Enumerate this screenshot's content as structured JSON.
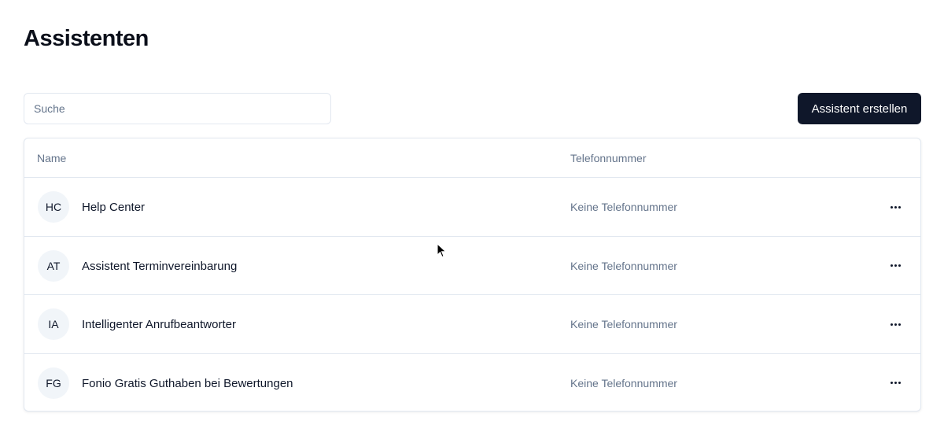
{
  "page": {
    "title": "Assistenten"
  },
  "search": {
    "placeholder": "Suche",
    "value": ""
  },
  "toolbar": {
    "create_label": "Assistent erstellen"
  },
  "table": {
    "headers": {
      "name": "Name",
      "phone": "Telefonnummer"
    },
    "rows": [
      {
        "initials": "HC",
        "name": "Help Center",
        "phone": "Keine Telefonnummer"
      },
      {
        "initials": "AT",
        "name": "Assistent Terminvereinbarung",
        "phone": "Keine Telefonnummer"
      },
      {
        "initials": "IA",
        "name": "Intelligenter Anrufbeantworter",
        "phone": "Keine Telefonnummer"
      },
      {
        "initials": "FG",
        "name": "Fonio Gratis Guthaben bei Bewertungen",
        "phone": "Keine Telefonnummer"
      }
    ]
  },
  "icons": {
    "row_menu": "more-horizontal-icon",
    "cursor": "mouse-pointer-icon"
  },
  "colors": {
    "primary_button": "#0f172a",
    "muted_text": "#64748b",
    "border": "#e2e8f0",
    "avatar_bg": "#f1f5f9"
  }
}
